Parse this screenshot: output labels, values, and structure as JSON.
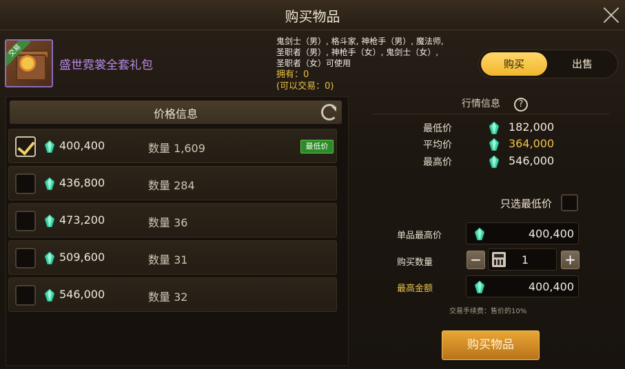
{
  "header": {
    "title": "购买物品"
  },
  "item": {
    "tag": "交易",
    "name": "盛世霓裳全套礼包",
    "classes_line1": "鬼剑士（男）, 格斗家, 神枪手（男）, 魔法师,",
    "classes_line2": "圣职者（男）, 神枪手（女）, 鬼剑士（女）,",
    "classes_line3": "圣职者（女）可使用",
    "owned": "拥有：0",
    "tradable": "(可以交易：0)"
  },
  "mode_toggle": {
    "buy_label": "购买",
    "sell_label": "出售",
    "selected": "buy"
  },
  "price_panel": {
    "header": "价格信息",
    "qty_prefix": "数量",
    "lowest_badge": "最低价",
    "rows": [
      {
        "price": "400,400",
        "qty": "1,609",
        "checked": true,
        "lowest": true
      },
      {
        "price": "436,800",
        "qty": "284",
        "checked": false,
        "lowest": false
      },
      {
        "price": "473,200",
        "qty": "36",
        "checked": false,
        "lowest": false
      },
      {
        "price": "509,600",
        "qty": "31",
        "checked": false,
        "lowest": false
      },
      {
        "price": "546,000",
        "qty": "32",
        "checked": false,
        "lowest": false
      }
    ]
  },
  "market": {
    "header": "行情信息",
    "help": "?",
    "min_label": "最低价",
    "min_value": "182,000",
    "avg_label": "平均价",
    "avg_value": "364,000",
    "max_label": "最高价",
    "max_value": "546,000"
  },
  "order": {
    "only_lowest_label": "只选最低价",
    "unit_max_label": "单品最高价",
    "unit_max_value": "400,400",
    "qty_label": "购买数量",
    "qty_value": "1",
    "total_label": "最高金额",
    "total_value": "400,400",
    "fee_note": "交易手续费：售价的10%",
    "buy_button": "购买物品",
    "minus": "−",
    "plus": "+"
  },
  "colors": {
    "accent": "#f1b52c",
    "gem": "#3fd6a8",
    "highlight_value": "#f3c44a",
    "label_gold": "#e8c24c"
  }
}
